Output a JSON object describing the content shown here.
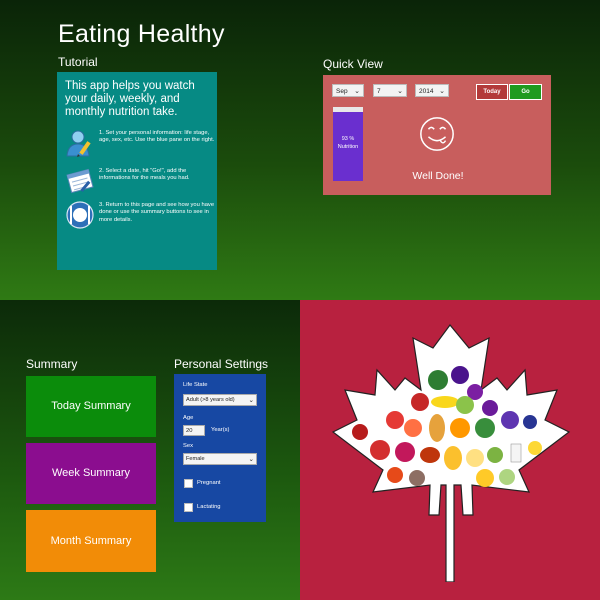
{
  "app": {
    "title": "Eating Healthy"
  },
  "tutorial": {
    "heading": "Tutorial",
    "intro": "This app helps you watch your daily, weekly, and monthly nutrition take.",
    "steps": [
      {
        "icon": "user-edit-icon",
        "text": "1. Set your personal information: life stage, age, sex, etc. Use the blue pane on the right."
      },
      {
        "icon": "calendar-edit-icon",
        "text": "2. Select a date, hit \"Go!\", add the informations for the meals you had."
      },
      {
        "icon": "plate-cutlery-icon",
        "text": "3. Return to this page and see how you have done or use the summary buttons to see in more details."
      }
    ]
  },
  "quick_view": {
    "heading": "Quick View",
    "month": "Sep",
    "day": "7",
    "year": "2014",
    "today_label": "Today",
    "go_label": "Go",
    "nutrition_percent": 93,
    "nutrition_value": "93 %",
    "nutrition_label": "Nutrition",
    "status": "Well Done!",
    "icon": "smiley-face-icon"
  },
  "summary": {
    "heading": "Summary",
    "tiles": [
      {
        "label": "Today Summary",
        "color": "#0b8c0b"
      },
      {
        "label": "Week Summary",
        "color": "#8b0d8f"
      },
      {
        "label": "Month Summary",
        "color": "#f28c07"
      }
    ]
  },
  "personal_settings": {
    "heading": "Personal Settings",
    "life_state_label": "Life State",
    "life_state_value": "Adult (>8 years old)",
    "age_label": "Age",
    "age_value": "20",
    "age_unit": "Year(s)",
    "sex_label": "Sex",
    "sex_value": "Female",
    "pregnant_label": "Pregnant",
    "lactating_label": "Lactating"
  },
  "hero": {
    "icon": "maple-leaf-food-icon",
    "color": "#b8213f"
  }
}
